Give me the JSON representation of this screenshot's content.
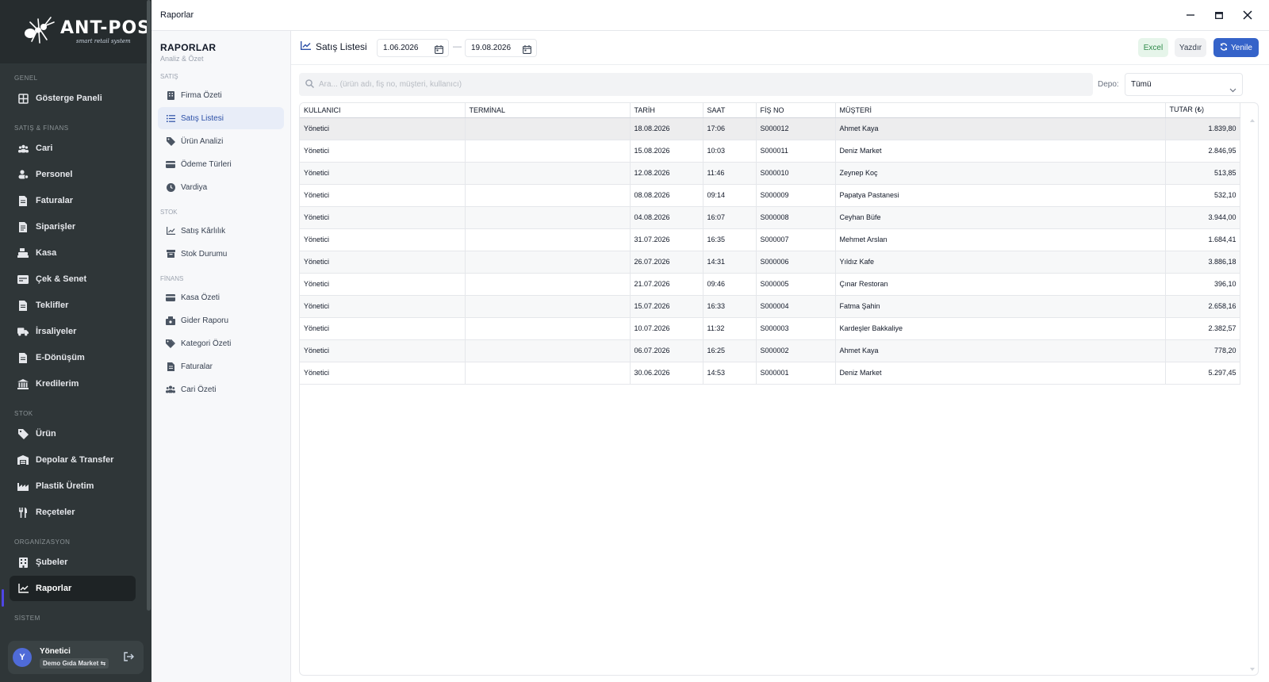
{
  "app": {
    "brand_title": "ANT-POS",
    "brand_subtitle": "smart retail system",
    "window_title": "Raporlar"
  },
  "sidebar": {
    "sections": [
      {
        "label": "GENEL",
        "items": [
          {
            "label": "Gösterge Paneli",
            "icon": "dashboard-icon"
          }
        ]
      },
      {
        "label": "SATIŞ & FİNANS",
        "items": [
          {
            "label": "Cari",
            "icon": "users-icon"
          },
          {
            "label": "Personel",
            "icon": "user-gear-icon"
          },
          {
            "label": "Faturalar",
            "icon": "invoice-icon"
          },
          {
            "label": "Siparişler",
            "icon": "order-icon"
          },
          {
            "label": "Kasa",
            "icon": "cash-register-icon"
          },
          {
            "label": "Çek & Senet",
            "icon": "check-icon"
          },
          {
            "label": "Teklifler",
            "icon": "offer-icon"
          },
          {
            "label": "İrsaliyeler",
            "icon": "truck-icon"
          },
          {
            "label": "E-Dönüşüm",
            "icon": "e-document-icon"
          },
          {
            "label": "Kredilerim",
            "icon": "bank-icon"
          }
        ]
      },
      {
        "label": "STOK",
        "items": [
          {
            "label": "Ürün",
            "icon": "tag-icon"
          },
          {
            "label": "Depolar & Transfer",
            "icon": "warehouse-icon"
          },
          {
            "label": "Plastik Üretim",
            "icon": "factory-icon"
          },
          {
            "label": "Reçeteler",
            "icon": "utensils-icon"
          }
        ]
      },
      {
        "label": "ORGANİZASYON",
        "items": [
          {
            "label": "Şubeler",
            "icon": "building-icon"
          },
          {
            "label": "Raporlar",
            "icon": "chart-line-icon",
            "active": true
          }
        ]
      },
      {
        "label": "SİSTEM",
        "items": []
      }
    ],
    "user": {
      "initial": "Y",
      "name": "Yönetici",
      "branch": "Demo Gıda Market"
    }
  },
  "subnav": {
    "title": "RAPORLAR",
    "subtitle": "Analiz & Özet",
    "sections": [
      {
        "label": "SATIŞ",
        "items": [
          {
            "label": "Firma Özeti",
            "icon": "building-icon"
          },
          {
            "label": "Satış Listesi",
            "icon": "list-icon",
            "active": true
          },
          {
            "label": "Ürün Analizi",
            "icon": "tag-icon"
          },
          {
            "label": "Ödeme Türleri",
            "icon": "card-icon"
          },
          {
            "label": "Vardiya",
            "icon": "clock-icon"
          }
        ]
      },
      {
        "label": "STOK",
        "items": [
          {
            "label": "Satış Kârlılık",
            "icon": "chart-line-icon"
          },
          {
            "label": "Stok Durumu",
            "icon": "box-icon"
          }
        ]
      },
      {
        "label": "FİNANS",
        "items": [
          {
            "label": "Kasa Özeti",
            "icon": "cash-register-icon"
          },
          {
            "label": "Gider Raporu",
            "icon": "expense-icon"
          },
          {
            "label": "Kategori Özeti",
            "icon": "tags-icon"
          },
          {
            "label": "Faturalar",
            "icon": "invoice-icon"
          },
          {
            "label": "Cari Özeti",
            "icon": "users-icon"
          }
        ]
      }
    ]
  },
  "toolbar": {
    "title": "Satış Listesi",
    "date_from": "1.06.2026",
    "date_to": "19.08.2026",
    "date_separator": "—",
    "excel_label": "Excel",
    "print_label": "Yazdır",
    "refresh_label": "Yenile"
  },
  "filters": {
    "search_placeholder": "Ara... (ürün adı, fiş no, müşteri, kullanıcı)",
    "depo_label": "Depo:",
    "depo_value": "Tümü"
  },
  "table": {
    "columns": [
      "KULLANICI",
      "TERMİNAL",
      "TARİH",
      "SAAT",
      "FİŞ NO",
      "MÜŞTERİ",
      "TUTAR (₺)"
    ],
    "rows": [
      [
        "Yönetici",
        "",
        "18.08.2026",
        "17:06",
        "S000012",
        "Ahmet Kaya",
        "1.839,80"
      ],
      [
        "Yönetici",
        "",
        "15.08.2026",
        "10:03",
        "S000011",
        "Deniz Market",
        "2.846,95"
      ],
      [
        "Yönetici",
        "",
        "12.08.2026",
        "11:46",
        "S000010",
        "Zeynep Koç",
        "513,85"
      ],
      [
        "Yönetici",
        "",
        "08.08.2026",
        "09:14",
        "S000009",
        "Papatya Pastanesi",
        "532,10"
      ],
      [
        "Yönetici",
        "",
        "04.08.2026",
        "16:07",
        "S000008",
        "Ceyhan Büfe",
        "3.944,00"
      ],
      [
        "Yönetici",
        "",
        "31.07.2026",
        "16:35",
        "S000007",
        "Mehmet Arslan",
        "1.684,41"
      ],
      [
        "Yönetici",
        "",
        "26.07.2026",
        "14:31",
        "S000006",
        "Yıldız Kafe",
        "3.886,18"
      ],
      [
        "Yönetici",
        "",
        "21.07.2026",
        "09:46",
        "S000005",
        "Çınar Restoran",
        "396,10"
      ],
      [
        "Yönetici",
        "",
        "15.07.2026",
        "16:33",
        "S000004",
        "Fatma Şahin",
        "2.658,16"
      ],
      [
        "Yönetici",
        "",
        "10.07.2026",
        "11:32",
        "S000003",
        "Kardeşler Bakkaliye",
        "2.382,57"
      ],
      [
        "Yönetici",
        "",
        "06.07.2026",
        "16:25",
        "S000002",
        "Ahmet Kaya",
        "778,20"
      ],
      [
        "Yönetici",
        "",
        "30.06.2026",
        "14:53",
        "S000001",
        "Deniz Market",
        "5.297,45"
      ]
    ]
  },
  "colors": {
    "sidebar_bg": "#2f3638",
    "accent": "#3563c9",
    "active_indicator": "#4f46e5",
    "excel_green": "#2f8a4a"
  }
}
